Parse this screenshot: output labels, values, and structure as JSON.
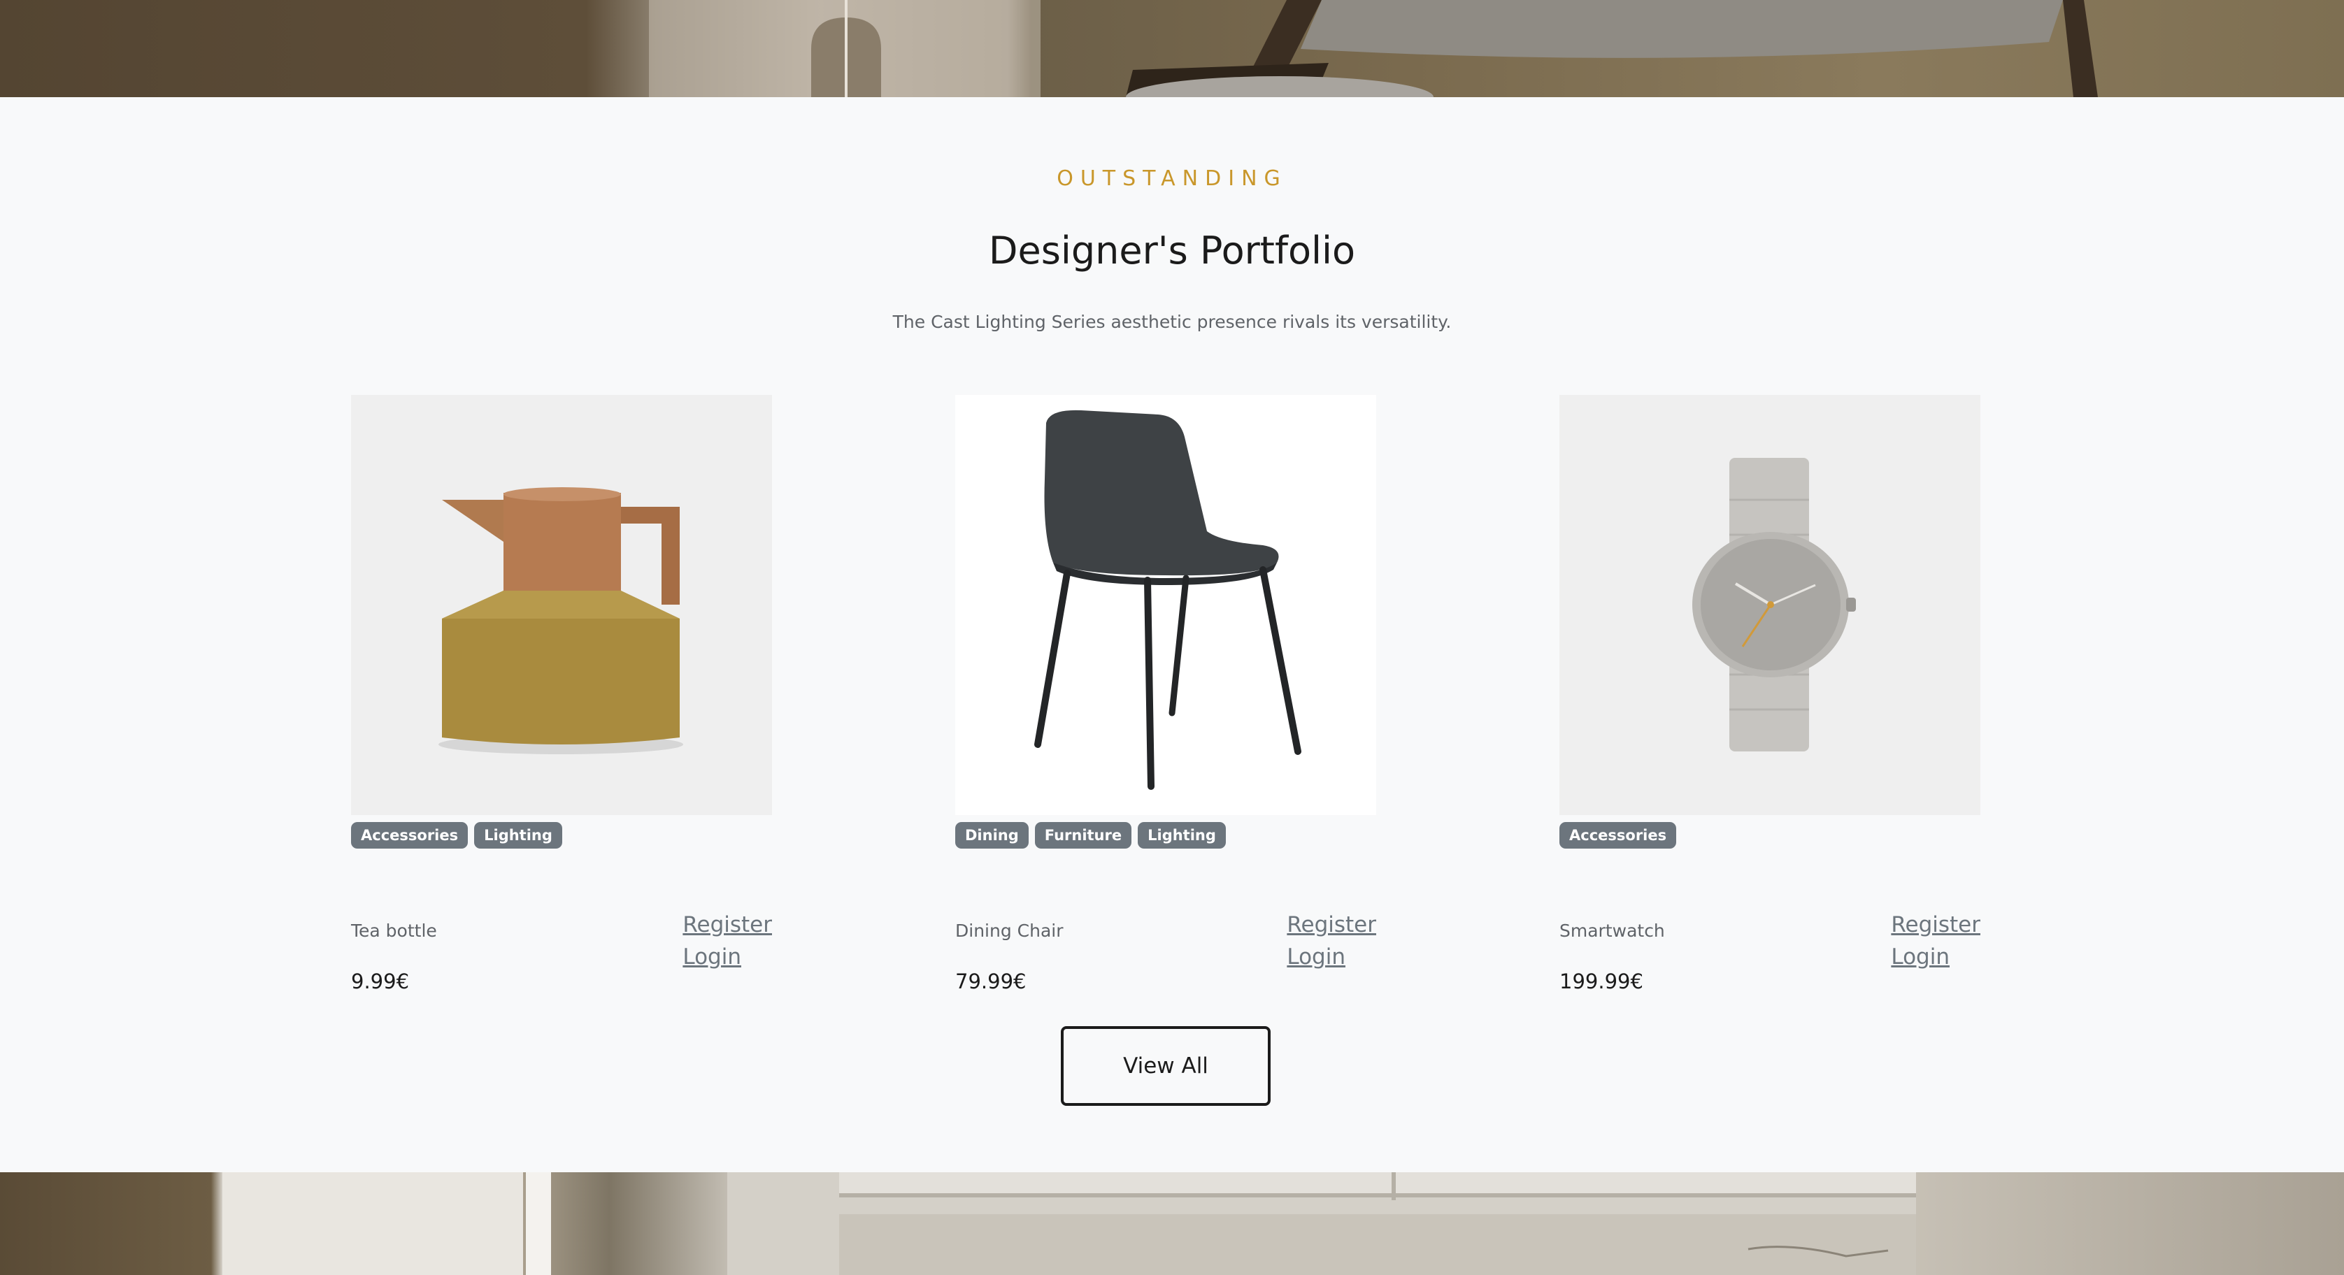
{
  "section": {
    "eyebrow": "OUTSTANDING",
    "title": "Designer's Portfolio",
    "subtitle": "The Cast Lighting Series aesthetic presence rivals its versatility."
  },
  "products": [
    {
      "name": "Tea bottle",
      "price": "9.99€",
      "tags": [
        "Accessories",
        "Lighting"
      ],
      "image_icon": "tea-bottle-image",
      "register_label": "Register",
      "login_label": "Login"
    },
    {
      "name": "Dining Chair",
      "price": "79.99€",
      "tags": [
        "Dining",
        "Furniture",
        "Lighting"
      ],
      "image_icon": "dining-chair-image",
      "register_label": "Register",
      "login_label": "Login"
    },
    {
      "name": "Smartwatch",
      "price": "199.99€",
      "tags": [
        "Accessories"
      ],
      "image_icon": "smartwatch-image",
      "register_label": "Register",
      "login_label": "Login"
    }
  ],
  "view_all_label": "View All",
  "colors": {
    "accent": "#c9972b",
    "tag_bg": "#6c757d",
    "background": "#f8f9fa",
    "text_dark": "#1b1b1b",
    "text_muted": "#5f6368"
  }
}
